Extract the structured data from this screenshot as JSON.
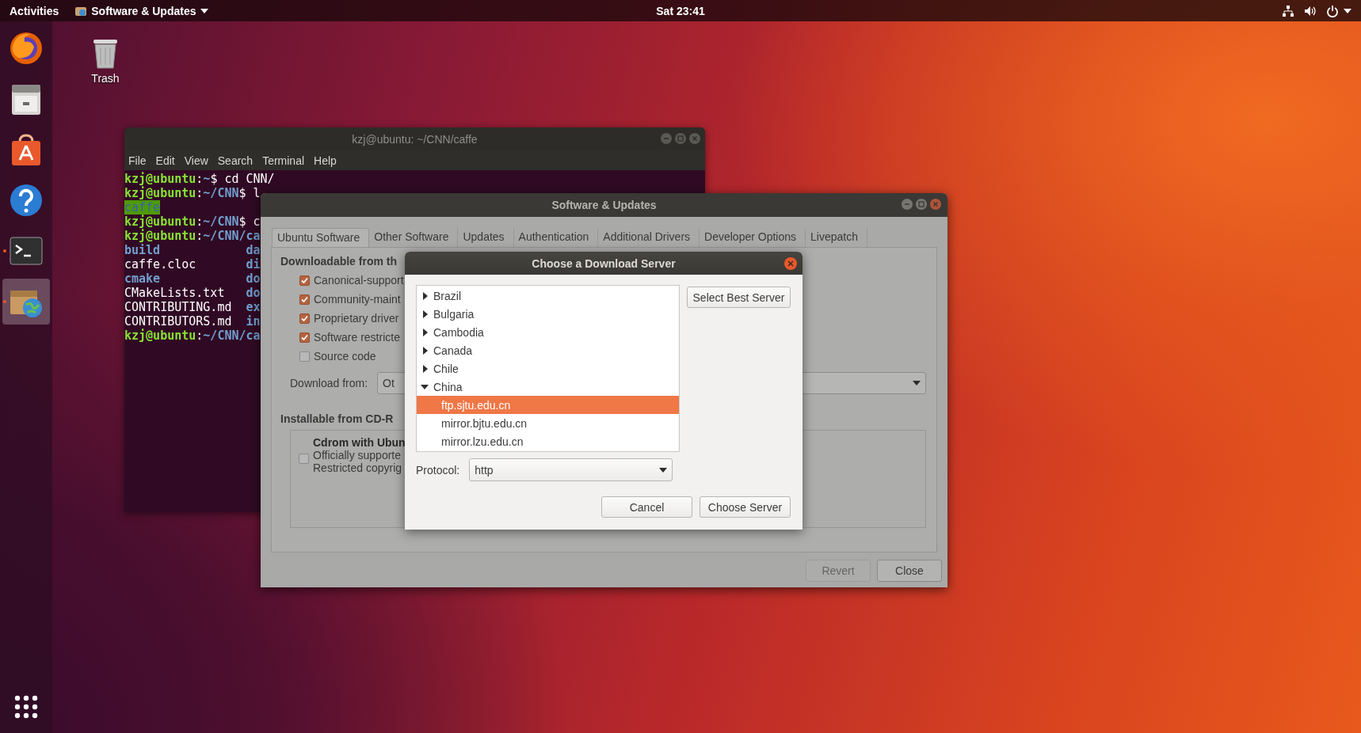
{
  "top_bar": {
    "activities": "Activities",
    "app_menu": "Software & Updates",
    "clock": "Sat 23:41"
  },
  "dock": {
    "items": [
      {
        "kind": "firefox",
        "running": false,
        "active": false
      },
      {
        "kind": "files",
        "running": false,
        "active": false
      },
      {
        "kind": "store",
        "running": false,
        "active": false
      },
      {
        "kind": "help",
        "running": false,
        "active": false
      },
      {
        "kind": "terminal",
        "running": true,
        "active": false
      },
      {
        "kind": "updates",
        "running": true,
        "active": true
      }
    ]
  },
  "desktop_icons": [
    {
      "label": "Trash"
    }
  ],
  "terminal": {
    "title": "kzj@ubuntu: ~/CNN/caffe",
    "menu": [
      "File",
      "Edit",
      "View",
      "Search",
      "Terminal",
      "Help"
    ],
    "lines": [
      [
        {
          "kind": "user",
          "text": "kzj@ubuntu"
        },
        {
          "kind": "plain",
          "text": ":"
        },
        {
          "kind": "path",
          "text": "~"
        },
        {
          "kind": "plain",
          "text": "$ cd CNN/"
        }
      ],
      [
        {
          "kind": "user",
          "text": "kzj@ubuntu"
        },
        {
          "kind": "plain",
          "text": ":"
        },
        {
          "kind": "path",
          "text": "~/CNN"
        },
        {
          "kind": "plain",
          "text": "$ l"
        }
      ],
      [
        {
          "kind": "highlight",
          "text": "caffe"
        }
      ],
      [
        {
          "kind": "user",
          "text": "kzj@ubuntu"
        },
        {
          "kind": "plain",
          "text": ":"
        },
        {
          "kind": "path",
          "text": "~/CNN"
        },
        {
          "kind": "plain",
          "text": "$ c"
        }
      ],
      [
        {
          "kind": "user",
          "text": "kzj@ubuntu"
        },
        {
          "kind": "plain",
          "text": ":"
        },
        {
          "kind": "path",
          "text": "~/CNN/ca"
        }
      ],
      [
        {
          "kind": "dir",
          "text": "build"
        },
        {
          "kind": "second_column_dir",
          "text": "da"
        }
      ],
      [
        {
          "kind": "plain",
          "text": "caffe.cloc"
        },
        {
          "kind": "second_column_dir",
          "text": "di"
        }
      ],
      [
        {
          "kind": "dir",
          "text": "cmake"
        },
        {
          "kind": "second_column_dir",
          "text": "do"
        }
      ],
      [
        {
          "kind": "plain",
          "text": "CMakeLists.txt"
        },
        {
          "kind": "second_column_dir",
          "text": "do"
        }
      ],
      [
        {
          "kind": "plain",
          "text": "CONTRIBUTING.md"
        },
        {
          "kind": "second_column_dir",
          "text": "ex"
        }
      ],
      [
        {
          "kind": "plain",
          "text": "CONTRIBUTORS.md"
        },
        {
          "kind": "second_column_dir",
          "text": "in"
        }
      ],
      [
        {
          "kind": "user",
          "text": "kzj@ubuntu"
        },
        {
          "kind": "plain",
          "text": ":"
        },
        {
          "kind": "path",
          "text": "~/CNN/ca"
        }
      ]
    ]
  },
  "software_updates": {
    "title": "Software & Updates",
    "tabs": [
      {
        "label": "Ubuntu Software",
        "selected": true
      },
      {
        "label": "Other Software",
        "selected": false
      },
      {
        "label": "Updates",
        "selected": false
      },
      {
        "label": "Authentication",
        "selected": false
      },
      {
        "label": "Additional Drivers",
        "selected": false
      },
      {
        "label": "Developer Options",
        "selected": false
      },
      {
        "label": "Livepatch",
        "selected": false
      }
    ],
    "section_title": "Downloadable from th",
    "sources": [
      {
        "label": "Canonical-support",
        "checked": true
      },
      {
        "label": "Community-maint",
        "checked": true
      },
      {
        "label": "Proprietary driver",
        "checked": true
      },
      {
        "label": "Software restricte",
        "checked": true
      },
      {
        "label": "Source code",
        "checked": false
      }
    ],
    "download_from_label": "Download from:",
    "download_from_value": "Ot",
    "cdrom_section_title": "Installable from CD-R",
    "cdrom": {
      "checked": false,
      "title": "Cdrom with Ubun",
      "lines": [
        "Officially supporte",
        "Restricted copyrig"
      ]
    },
    "buttons": [
      {
        "label": "Revert",
        "disabled": true
      },
      {
        "label": "Close",
        "disabled": false
      }
    ]
  },
  "server_dialog": {
    "title": "Choose a Download Server",
    "countries": [
      {
        "name": "Brazil",
        "expanded": false
      },
      {
        "name": "Bulgaria",
        "expanded": false
      },
      {
        "name": "Cambodia",
        "expanded": false
      },
      {
        "name": "Canada",
        "expanded": false
      },
      {
        "name": "Chile",
        "expanded": false
      },
      {
        "name": "China",
        "expanded": true,
        "children": [
          {
            "name": "ftp.sjtu.edu.cn",
            "selected": true
          },
          {
            "name": "mirror.bjtu.edu.cn",
            "selected": false
          },
          {
            "name": "mirror.lzu.edu.cn",
            "selected": false
          }
        ]
      }
    ],
    "select_best": "Select Best Server",
    "protocol_label": "Protocol:",
    "protocol_value": "http",
    "buttons": [
      {
        "label": "Cancel"
      },
      {
        "label": "Choose Server"
      }
    ]
  }
}
